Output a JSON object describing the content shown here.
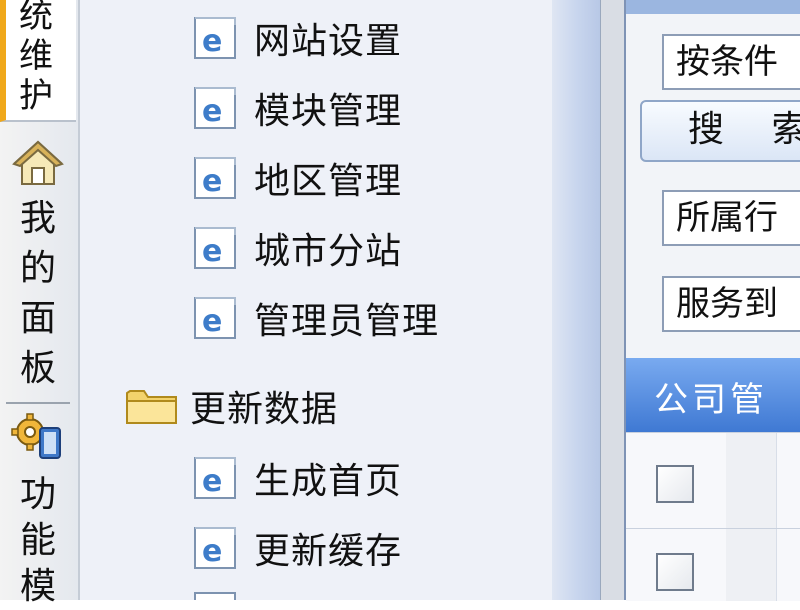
{
  "vertical_tabs": {
    "active_tab_label": "统维护",
    "panel_tab_label": "我的面板",
    "function_tab_label": "功能模"
  },
  "tree": {
    "items_group1": [
      {
        "label": "网站设置",
        "icon": "ie-page-icon"
      },
      {
        "label": "模块管理",
        "icon": "ie-page-icon"
      },
      {
        "label": "地区管理",
        "icon": "ie-page-icon"
      },
      {
        "label": "城市分站",
        "icon": "ie-page-icon"
      },
      {
        "label": "管理员管理",
        "icon": "ie-page-icon"
      }
    ],
    "folder": {
      "label": "更新数据",
      "icon": "folder-icon"
    },
    "items_group2": [
      {
        "label": "生成首页",
        "icon": "ie-page-icon"
      },
      {
        "label": "更新缓存",
        "icon": "ie-page-icon"
      }
    ]
  },
  "search": {
    "condition_select": "按条件",
    "search_button": "搜 索",
    "industry_select": "所属行",
    "service_select": "服务到"
  },
  "grid": {
    "header_title": "公司管"
  },
  "colors": {
    "active_tab_accent": "#f0a81a",
    "grid_header": "#3f79d3",
    "tree_background": "#eef1f8"
  }
}
